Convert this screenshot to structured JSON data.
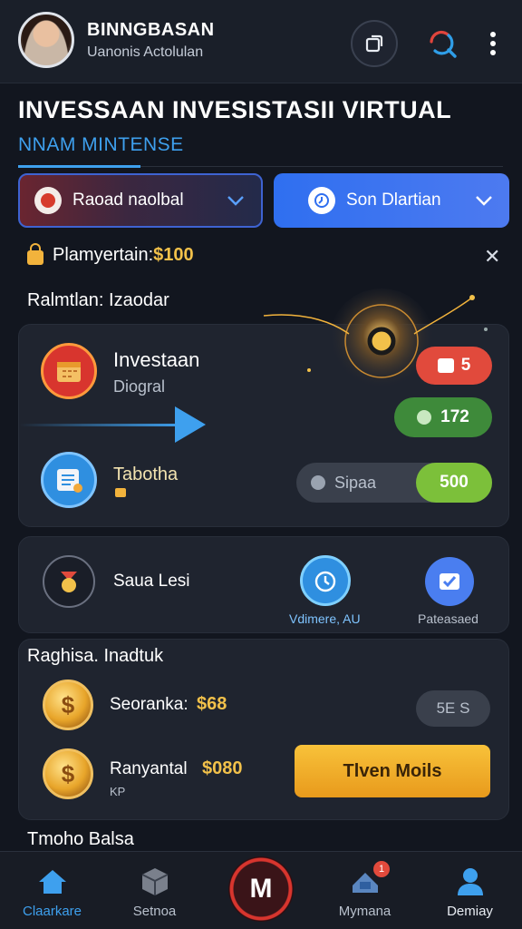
{
  "header": {
    "user_name": "BINNGBASAN",
    "user_subtitle": "Uanonis Actolulan"
  },
  "page": {
    "title": "INVESSAAN INVESISTASII VIRTUAL",
    "subtitle": "NNAM MINTENSE"
  },
  "dropdowns": {
    "left_label": "Raoad naolbal",
    "right_label": "Son Dlartian"
  },
  "promo": {
    "label": "Plamyertain:",
    "amount": "$100"
  },
  "section1": {
    "title": "Ralmtlan: Izaodar"
  },
  "card1": {
    "item1_title": "Investaan",
    "item1_sub": "Diogral",
    "item2_title": "Tabotha",
    "badge_red": "5",
    "badge_green": "172",
    "toggle_label": "Sipaa",
    "toggle_value": "500"
  },
  "card2": {
    "item_label": "Saua Lesi",
    "action1_label": "Vdimere, AU",
    "action2_label": "Pateasaed"
  },
  "section2": {
    "title": "Raghisa. Inadtuk"
  },
  "card3": {
    "row1_label": "Seoranka:",
    "row1_value": "$68",
    "row1_btn": "5E S",
    "row2_label": "Ranyantal",
    "row2_value": "$080",
    "row2_sub": "KP",
    "row2_btn": "Tlven Moils"
  },
  "bottom_section": {
    "title": "Tmoho Balsa"
  },
  "navbar": {
    "item1": "Claarkare",
    "item2": "Setnoa",
    "center": "M",
    "item4": "Mymana",
    "item5": "Demiay",
    "badge": "1"
  },
  "colors": {
    "accent_blue": "#3ea0ee",
    "gold": "#f2c14a",
    "nav_active": "#3ea0ee"
  }
}
